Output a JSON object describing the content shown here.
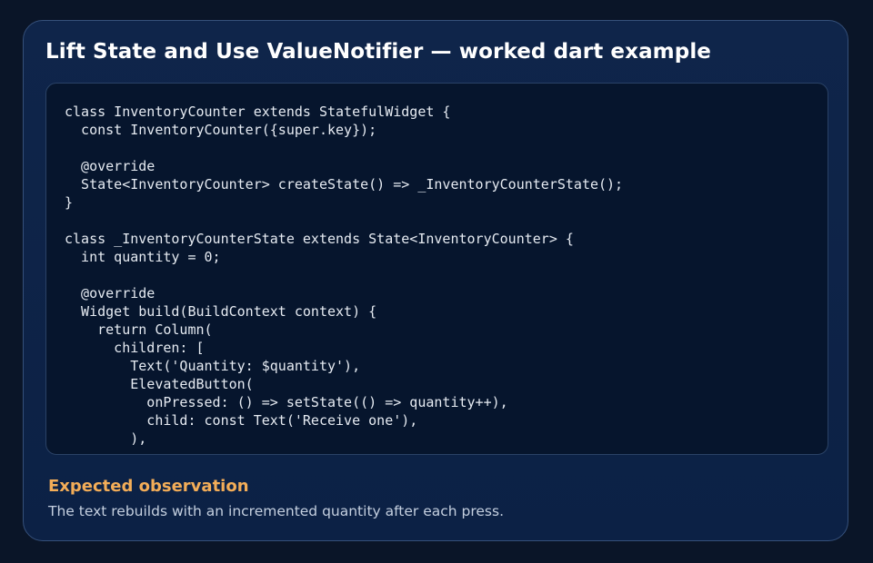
{
  "card": {
    "title": "Lift State and Use ValueNotifier — worked dart example"
  },
  "code": {
    "language": "dart",
    "text": "class InventoryCounter extends StatefulWidget {\n  const InventoryCounter({super.key});\n\n  @override\n  State<InventoryCounter> createState() => _InventoryCounterState();\n}\n\nclass _InventoryCounterState extends State<InventoryCounter> {\n  int quantity = 0;\n\n  @override\n  Widget build(BuildContext context) {\n    return Column(\n      children: [\n        Text('Quantity: $quantity'),\n        ElevatedButton(\n          onPressed: () => setState(() => quantity++),\n          child: const Text('Receive one'),\n        ),"
  },
  "observation": {
    "heading": "Expected observation",
    "text": "The text rebuilds with an incremented quantity after each press."
  },
  "colors": {
    "page_background": "#0a1528",
    "card_background": "#0f254a",
    "card_border": "#35507a",
    "code_background": "#06152d",
    "code_text": "#e6ebf2",
    "title_text": "#ffffff",
    "observation_heading": "#f3ad58",
    "observation_text": "#c4cfdf"
  }
}
